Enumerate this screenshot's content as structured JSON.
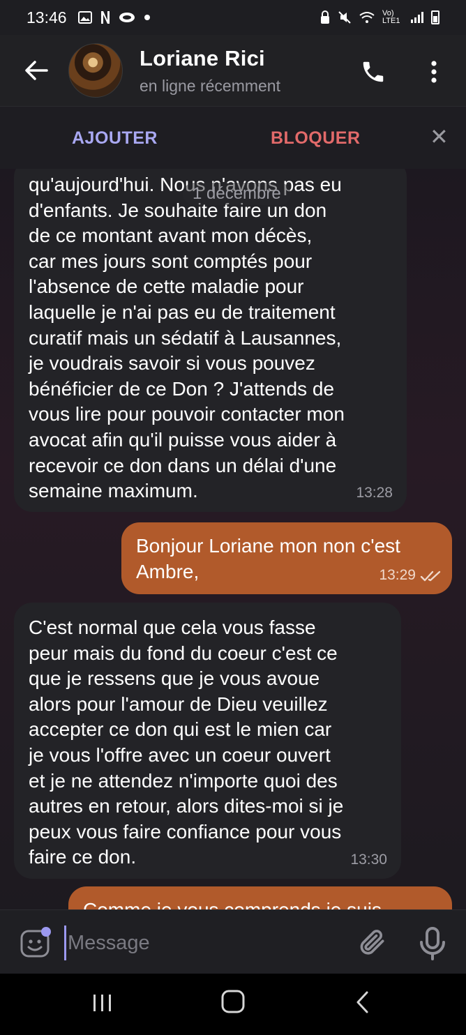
{
  "status_bar": {
    "time": "13:46",
    "network_label": "Vo) LTE1"
  },
  "header": {
    "contact_name": "Loriane Rici",
    "contact_status": "en ligne récemment",
    "icons": {
      "back": "arrow-left-icon",
      "call": "phone-icon",
      "menu": "more-vertical-icon"
    }
  },
  "action_bar": {
    "add_label": "AJOUTER",
    "block_label": "BLOQUER",
    "close_glyph": "✕"
  },
  "chat": {
    "date_separator": "1 décembre",
    "messages": [
      {
        "direction": "incoming",
        "text": "qu'aujourd'hui.  Nous n'avons pas eu\nd'enfants.  Je souhaite faire un don\nde ce montant avant mon décès,\ncar mes jours sont comptés pour\nl'absence de cette maladie pour\nlaquelle je n'ai pas eu de traitement\ncuratif mais un sédatif à Lausannes,\nje voudrais savoir si vous pouvez\nbénéficier de ce Don ?  J'attends de\nvous lire pour pouvoir contacter mon\navocat afin qu'il puisse vous aider à\nrecevoir ce don dans un délai d'une\nsemaine maximum.",
        "time": "13:28"
      },
      {
        "direction": "outgoing",
        "text": "Bonjour Loriane mon non c'est\nAmbre,",
        "time": "13:29",
        "read": true
      },
      {
        "direction": "incoming",
        "text": "C'est normal que cela vous fasse\npeur mais du fond du coeur c'est ce\nque je ressens que je vous avoue\nalors pour l'amour de Dieu veuillez\naccepter ce don qui est le mien car\nje vous l'offre avec un coeur ouvert\net je ne attendez n'importe quoi des\nautres en retour, alors dites-moi si je\npeux vous faire confiance pour vous\nfaire ce don.",
        "time": "13:30"
      },
      {
        "direction": "outgoing",
        "text": "Comme je vous comprends je suis",
        "time": ""
      }
    ]
  },
  "composer": {
    "placeholder": "Message",
    "icons": {
      "emoji": "sticker-emoji-icon",
      "attach": "paperclip-icon",
      "mic": "microphone-icon"
    }
  },
  "colors": {
    "accent": "#a9a8f2",
    "block": "#e26a6a",
    "outgoing_bubble": "#b15a2b",
    "incoming_bubble": "#232327"
  }
}
